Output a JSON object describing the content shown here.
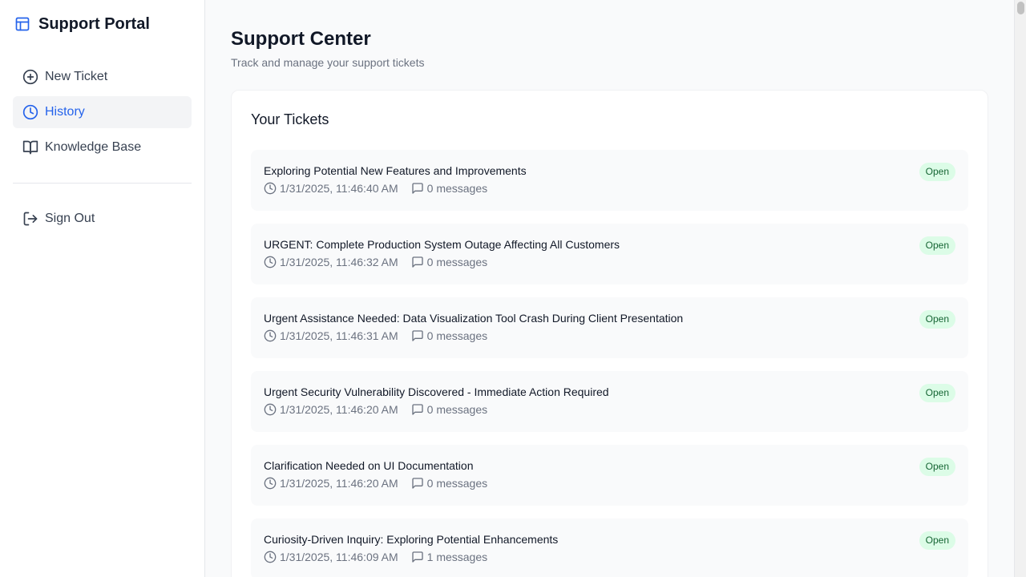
{
  "sidebar": {
    "brand": "Support Portal",
    "items": [
      {
        "label": "New Ticket",
        "icon": "plus-circle-icon"
      },
      {
        "label": "History",
        "icon": "clock-icon",
        "active": true
      },
      {
        "label": "Knowledge Base",
        "icon": "book-open-icon"
      }
    ],
    "sign_out": "Sign Out"
  },
  "header": {
    "title": "Support Center",
    "subtitle": "Track and manage your support tickets"
  },
  "tickets_card": {
    "title": "Your Tickets",
    "tickets": [
      {
        "title": "Exploring Potential New Features and Improvements",
        "timestamp": "1/31/2025, 11:46:40 AM",
        "messages": "0 messages",
        "status": "Open"
      },
      {
        "title": "URGENT: Complete Production System Outage Affecting All Customers",
        "timestamp": "1/31/2025, 11:46:32 AM",
        "messages": "0 messages",
        "status": "Open"
      },
      {
        "title": "Urgent Assistance Needed: Data Visualization Tool Crash During Client Presentation",
        "timestamp": "1/31/2025, 11:46:31 AM",
        "messages": "0 messages",
        "status": "Open"
      },
      {
        "title": "Urgent Security Vulnerability Discovered - Immediate Action Required",
        "timestamp": "1/31/2025, 11:46:20 AM",
        "messages": "0 messages",
        "status": "Open"
      },
      {
        "title": "Clarification Needed on UI Documentation",
        "timestamp": "1/31/2025, 11:46:20 AM",
        "messages": "0 messages",
        "status": "Open"
      },
      {
        "title": "Curiosity-Driven Inquiry: Exploring Potential Enhancements",
        "timestamp": "1/31/2025, 11:46:09 AM",
        "messages": "1 messages",
        "status": "Open"
      }
    ]
  },
  "colors": {
    "accent": "#2563eb",
    "badge_bg": "#dcfce7",
    "badge_text": "#166534"
  }
}
